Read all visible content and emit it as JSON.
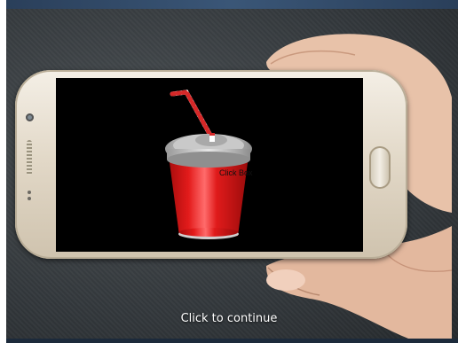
{
  "screen": {
    "cup_label": "Click Box",
    "cup_label_visible": "Click Box"
  },
  "footer": {
    "continue_label": "Click to continue"
  },
  "colors": {
    "cup_red": "#e01b1b",
    "screen_bg": "#000000",
    "background": "#3a3f43"
  },
  "icons": {
    "camera": "front-camera-icon",
    "home": "home-button-icon"
  }
}
